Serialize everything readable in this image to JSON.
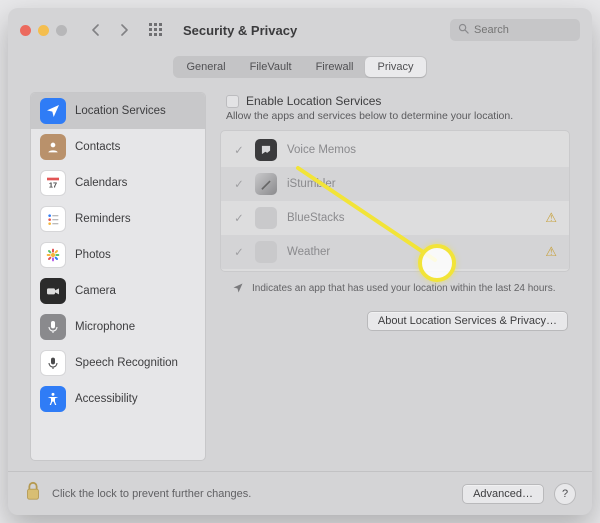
{
  "window": {
    "title": "Security & Privacy"
  },
  "search": {
    "placeholder": "Search"
  },
  "tabs": {
    "general": "General",
    "filevault": "FileVault",
    "firewall": "Firewall",
    "privacy": "Privacy"
  },
  "sidebar": {
    "items": [
      {
        "label": "Location Services"
      },
      {
        "label": "Contacts"
      },
      {
        "label": "Calendars"
      },
      {
        "label": "Reminders"
      },
      {
        "label": "Photos"
      },
      {
        "label": "Camera"
      },
      {
        "label": "Microphone"
      },
      {
        "label": "Speech Recognition"
      },
      {
        "label": "Accessibility"
      }
    ]
  },
  "detail": {
    "enable_label": "Enable Location Services",
    "description": "Allow the apps and services below to determine your location.",
    "apps": [
      {
        "name": "Voice Memos"
      },
      {
        "name": "iStumbler"
      },
      {
        "name": "BlueStacks"
      },
      {
        "name": "Weather"
      }
    ],
    "hint": "Indicates an app that has used your location within the last 24 hours.",
    "about_button": "About Location Services & Privacy…"
  },
  "footer": {
    "lock_text": "Click the lock to prevent further changes.",
    "advanced": "Advanced…",
    "help": "?"
  }
}
